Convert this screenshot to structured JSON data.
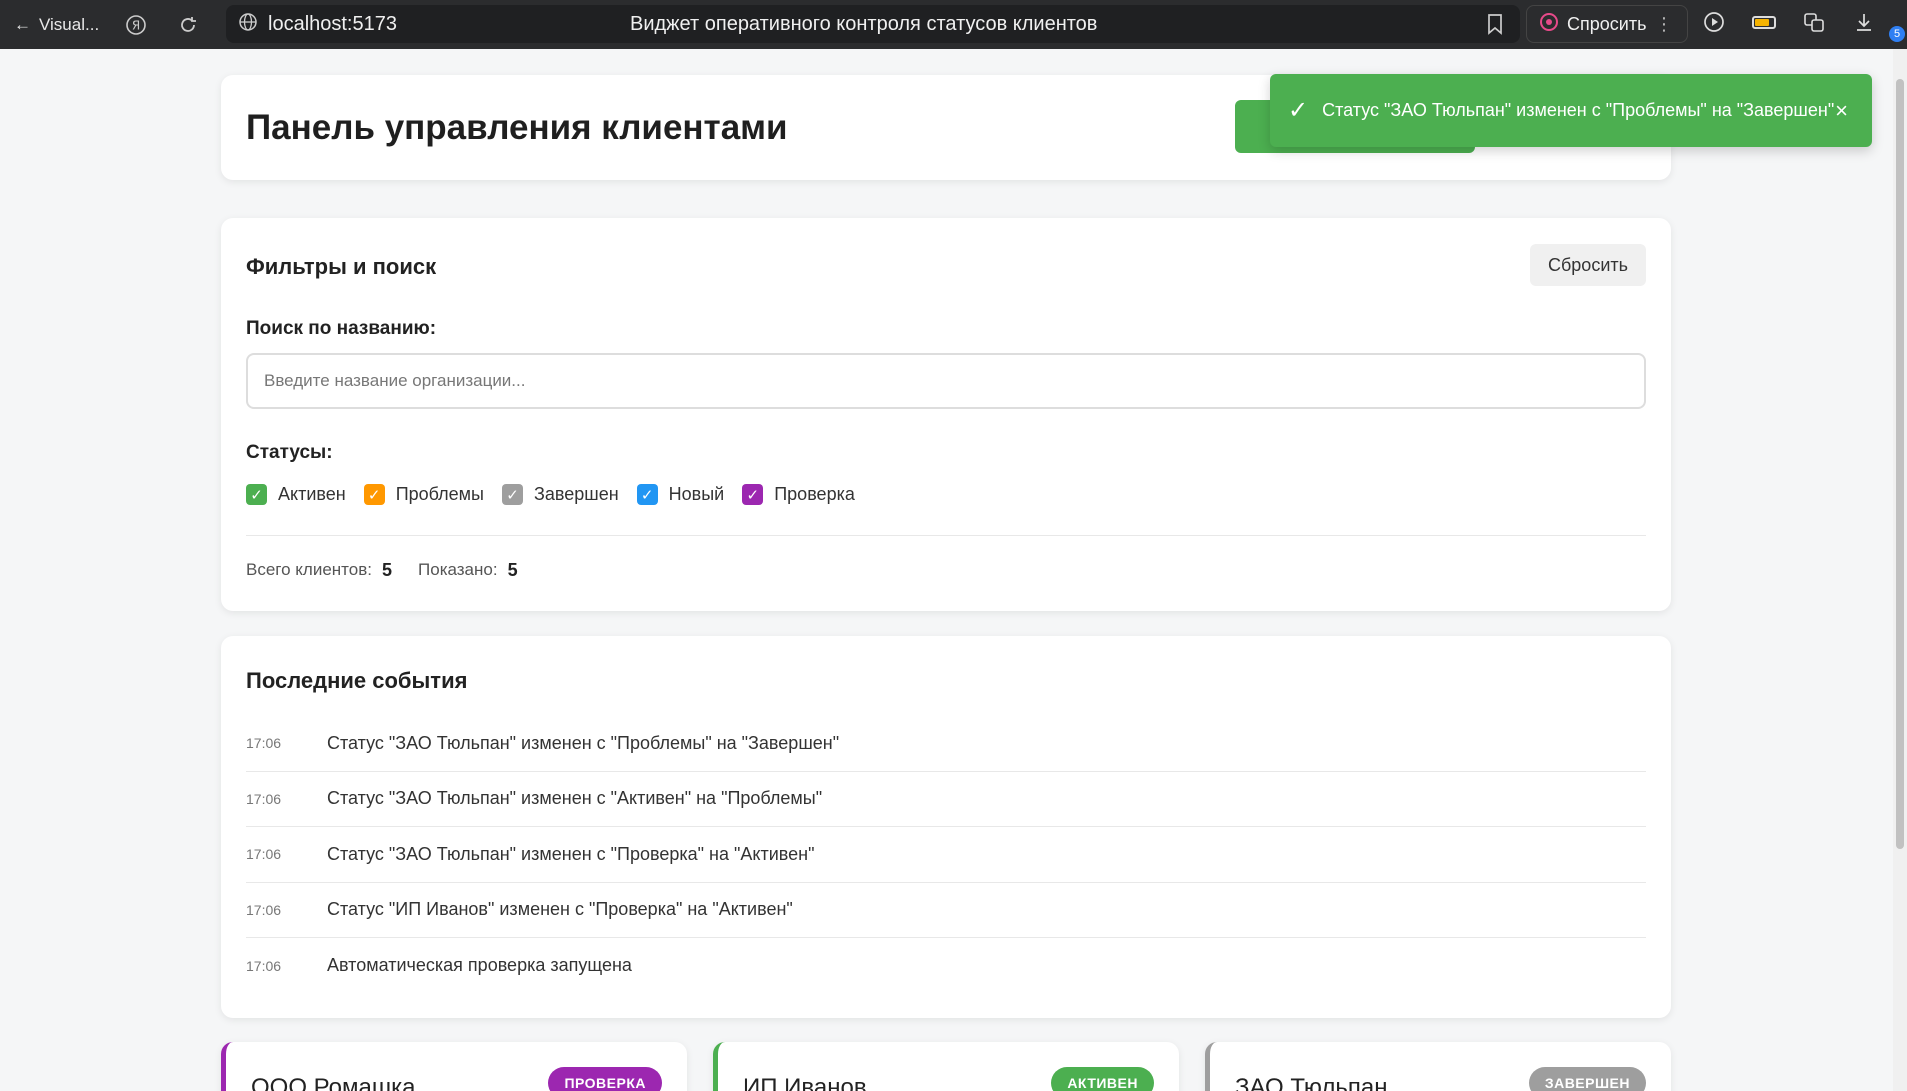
{
  "browser": {
    "back_label": "Visual...",
    "url": "localhost:5173",
    "page_title": "Виджет оперативного контроля статусов клиентов",
    "ask_label": "Спросить",
    "downloads_count": "5"
  },
  "header": {
    "title": "Панель управления клиентами"
  },
  "toast": {
    "message": "Статус \"ЗАО Тюльпан\" изменен с \"Проблемы\" на \"Завершен\"",
    "close_label": "×"
  },
  "filters": {
    "title": "Фильтры и поиск",
    "reset_label": "Сбросить",
    "search_label": "Поиск по названию:",
    "search_placeholder": "Введите название организации...",
    "search_value": "",
    "statuses_label": "Статусы:",
    "statuses": [
      {
        "label": "Активен",
        "color": "#4caf50",
        "checked": true
      },
      {
        "label": "Проблемы",
        "color": "#ff9800",
        "checked": true
      },
      {
        "label": "Завершен",
        "color": "#9e9e9e",
        "checked": true
      },
      {
        "label": "Новый",
        "color": "#2196f3",
        "checked": true
      },
      {
        "label": "Проверка",
        "color": "#9c27b0",
        "checked": true
      }
    ],
    "total_label": "Всего клиентов:",
    "total_value": "5",
    "shown_label": "Показано:",
    "shown_value": "5"
  },
  "events": {
    "title": "Последние события",
    "items": [
      {
        "time": "17:06",
        "message": "Статус \"ЗАО Тюльпан\" изменен с \"Проблемы\" на \"Завершен\""
      },
      {
        "time": "17:06",
        "message": "Статус \"ЗАО Тюльпан\" изменен с \"Активен\" на \"Проблемы\""
      },
      {
        "time": "17:06",
        "message": "Статус \"ЗАО Тюльпан\" изменен с \"Проверка\" на \"Активен\""
      },
      {
        "time": "17:06",
        "message": "Статус \"ИП Иванов\" изменен с \"Проверка\" на \"Активен\""
      },
      {
        "time": "17:06",
        "message": "Автоматическая проверка запущена"
      }
    ]
  },
  "clients": [
    {
      "name": "ООО Ромашка",
      "status": "ПРОВЕРКА",
      "color": "#9c27b0"
    },
    {
      "name": "ИП Иванов",
      "status": "АКТИВЕН",
      "color": "#4caf50"
    },
    {
      "name": "ЗАО Тюльпан",
      "status": "ЗАВЕРШЕН",
      "color": "#9e9e9e"
    }
  ]
}
